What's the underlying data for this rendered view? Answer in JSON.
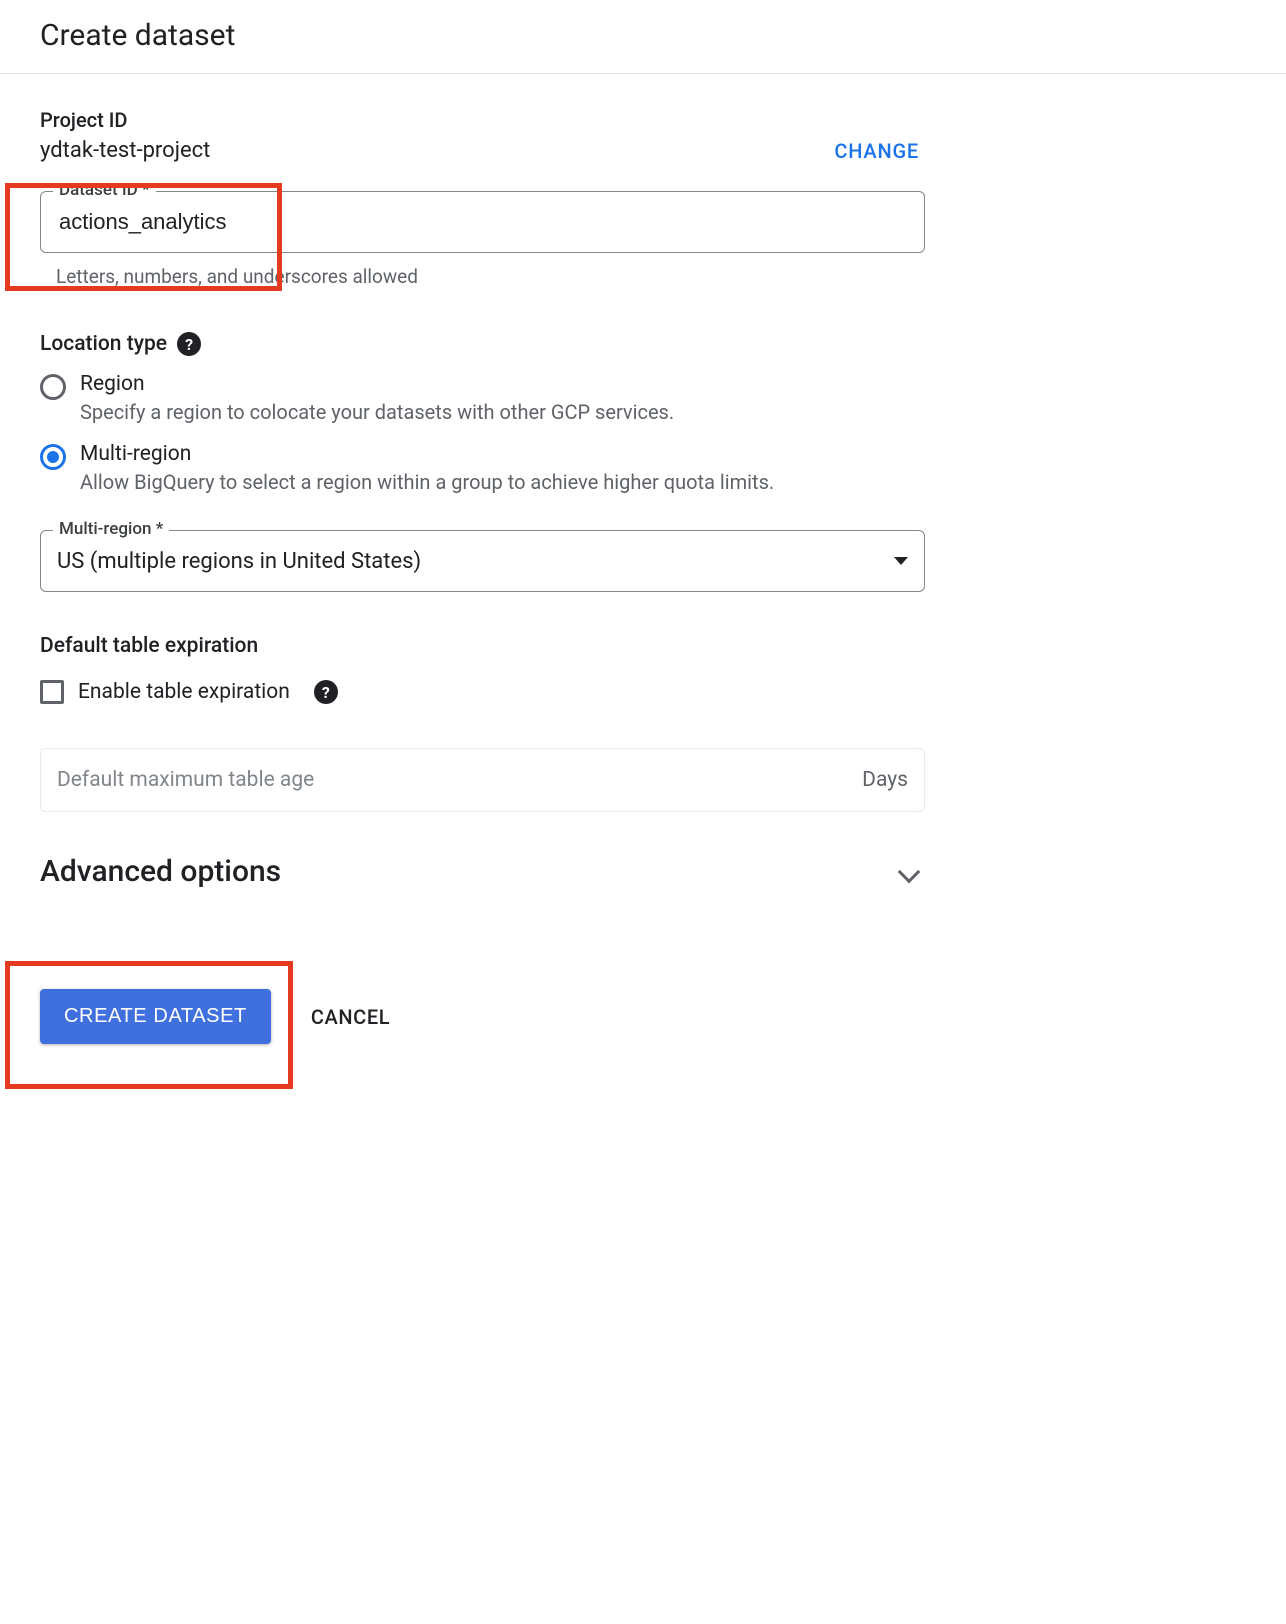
{
  "header": {
    "title": "Create dataset"
  },
  "project": {
    "label": "Project ID",
    "value": "ydtak-test-project",
    "change_label": "CHANGE"
  },
  "dataset_id": {
    "label": "Dataset ID *",
    "value": "actions_analytics",
    "helper": "Letters, numbers, and underscores allowed"
  },
  "location": {
    "title": "Location type",
    "options": [
      {
        "label": "Region",
        "desc": "Specify a region to colocate your datasets with other GCP services.",
        "selected": false
      },
      {
        "label": "Multi-region",
        "desc": "Allow BigQuery to select a region within a group to achieve higher quota limits.",
        "selected": true
      }
    ],
    "select_label": "Multi-region *",
    "select_value": "US (multiple regions in United States)"
  },
  "expiration": {
    "title": "Default table expiration",
    "checkbox_label": "Enable table expiration",
    "checked": false,
    "max_age_placeholder": "Default maximum table age",
    "max_age_suffix": "Days"
  },
  "advanced": {
    "title": "Advanced options"
  },
  "buttons": {
    "create": "CREATE DATASET",
    "cancel": "CANCEL"
  }
}
